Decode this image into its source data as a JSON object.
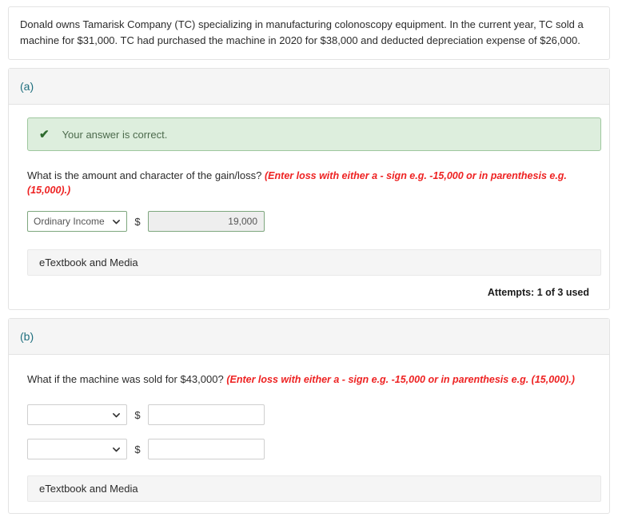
{
  "prompt": {
    "text": "Donald owns Tamarisk Company (TC) specializing in manufacturing colonoscopy equipment. In the current year, TC sold a machine for $31,000. TC had purchased the machine in 2020 for $38,000 and deducted depreciation expense of $26,000."
  },
  "hint_text": "(Enter loss with either a - sign e.g. -15,000 or in parenthesis e.g. (15,000).)",
  "colors": {
    "accent_label": "#1f6f7e",
    "hint_red": "#ee2222",
    "success_bg": "#ddeedd",
    "success_border": "#9ec79e",
    "success_check": "#2d6a2d",
    "correct_field_border": "#7ea77e",
    "header_band": "#f5f5f5"
  },
  "parts": [
    {
      "label": "(a)",
      "alert": {
        "icon": "check-icon",
        "text": "Your answer is correct."
      },
      "question": "What is the amount and character of the gain/loss?",
      "rows": [
        {
          "select_value": "Ordinary Income",
          "select_placeholder": "",
          "currency_symbol": "$",
          "amount_value": "19,000",
          "amount_placeholder": "",
          "state": "correct"
        }
      ],
      "etextbook_label": "eTextbook and Media",
      "attempts": "Attempts: 1 of 3 used"
    },
    {
      "label": "(b)",
      "question": "What if the machine was sold for $43,000?",
      "rows": [
        {
          "select_value": "",
          "select_placeholder": "",
          "currency_symbol": "$",
          "amount_value": "",
          "amount_placeholder": "",
          "state": "empty"
        },
        {
          "select_value": "",
          "select_placeholder": "",
          "currency_symbol": "$",
          "amount_value": "",
          "amount_placeholder": "",
          "state": "empty"
        }
      ],
      "etextbook_label": "eTextbook and Media"
    }
  ]
}
